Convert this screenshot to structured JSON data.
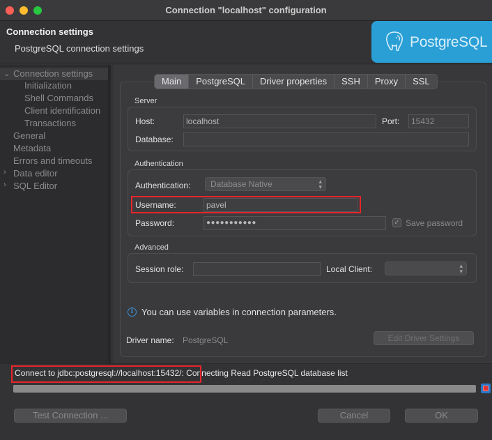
{
  "window": {
    "title": "Connection \"localhost\" configuration"
  },
  "header": {
    "title": "Connection settings",
    "subtitle": "PostgreSQL connection settings",
    "logo_text": "PostgreSQL",
    "logo_color": "#2a9fd6"
  },
  "sidebar": {
    "items": [
      {
        "label": "Connection settings",
        "level": 0,
        "expanded": true,
        "selected": true
      },
      {
        "label": "Initialization",
        "level": 1
      },
      {
        "label": "Shell Commands",
        "level": 1
      },
      {
        "label": "Client identification",
        "level": 1
      },
      {
        "label": "Transactions",
        "level": 1
      },
      {
        "label": "General",
        "level": 0
      },
      {
        "label": "Metadata",
        "level": 0
      },
      {
        "label": "Errors and timeouts",
        "level": 0
      },
      {
        "label": "Data editor",
        "level": 0,
        "collapsed": true
      },
      {
        "label": "SQL Editor",
        "level": 0,
        "collapsed": true
      }
    ]
  },
  "tabs": [
    "Main",
    "PostgreSQL",
    "Driver properties",
    "SSH",
    "Proxy",
    "SSL"
  ],
  "active_tab": "Main",
  "server": {
    "group_label": "Server",
    "host_label": "Host:",
    "host_value": "localhost",
    "port_label": "Port:",
    "port_value": "15432",
    "database_label": "Database:",
    "database_value": ""
  },
  "authentication": {
    "group_label": "Authentication",
    "auth_label": "Authentication:",
    "auth_value": "Database Native",
    "username_label": "Username:",
    "username_value": "pavel",
    "password_label": "Password:",
    "password_value": "●●●●●●●●●●●",
    "save_password_label": "Save password",
    "save_password_checked": true
  },
  "advanced": {
    "group_label": "Advanced",
    "session_role_label": "Session role:",
    "session_role_value": "",
    "local_client_label": "Local Client:",
    "local_client_value": ""
  },
  "info": {
    "text": "You can use variables in connection parameters."
  },
  "driver": {
    "label": "Driver name:",
    "value": "PostgreSQL",
    "edit_button": "Edit Driver Settings"
  },
  "status": {
    "text": "Connect to jdbc:postgresql://localhost:15432/: Connecting Read PostgreSQL database list",
    "progress": 1.0
  },
  "buttons": {
    "test_connection": "Test Connection ...",
    "cancel": "Cancel",
    "ok": "OK"
  },
  "colors": {
    "highlight_border": "#e8252b",
    "info_accent": "#3d8fd6"
  }
}
